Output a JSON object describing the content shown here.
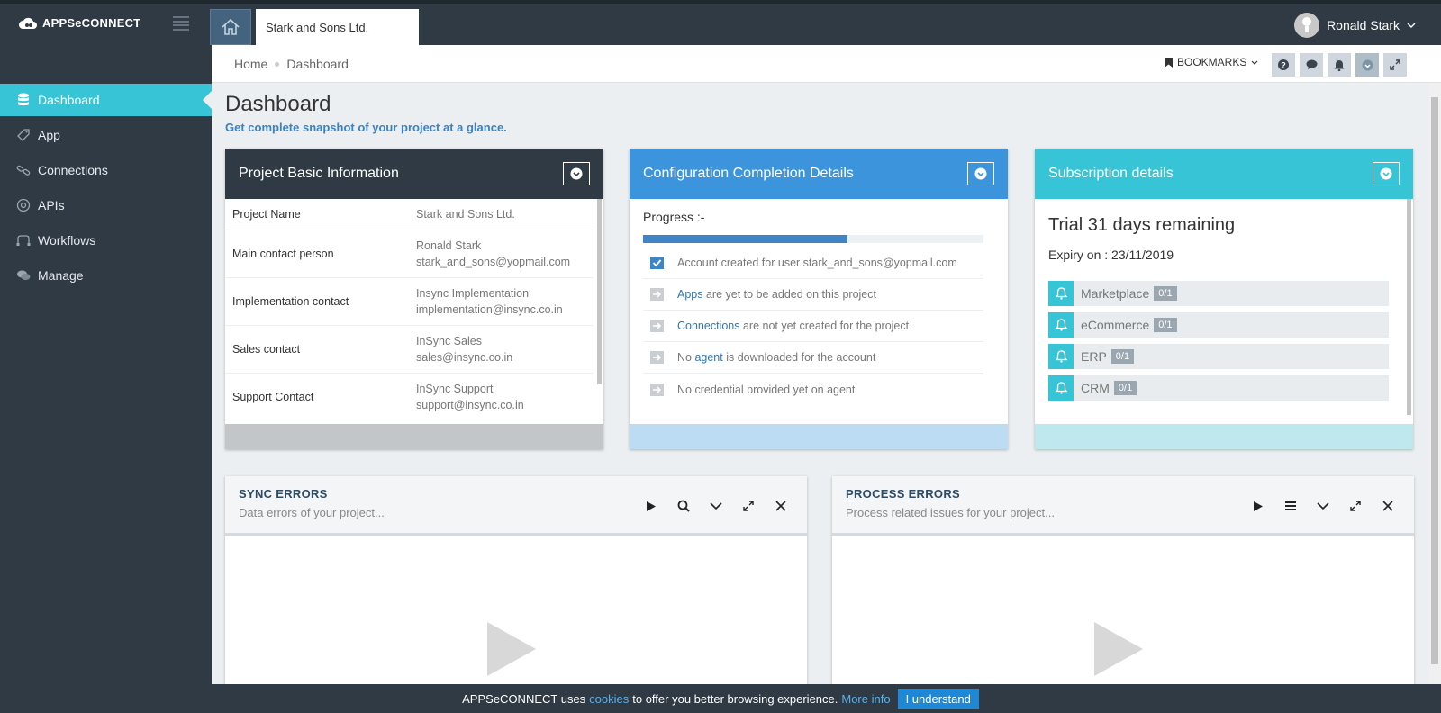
{
  "app": {
    "logo_text": "APPSeCONNECT"
  },
  "header": {
    "project_tab": "Stark and Sons Ltd.",
    "user_name": "Ronald Stark"
  },
  "sidebar": {
    "items": [
      {
        "label": "Dashboard",
        "icon": "database-icon",
        "active": true
      },
      {
        "label": "App",
        "icon": "tag-icon"
      },
      {
        "label": "Connections",
        "icon": "link-icon"
      },
      {
        "label": "APIs",
        "icon": "cog-icon"
      },
      {
        "label": "Workflows",
        "icon": "workflow-icon"
      },
      {
        "label": "Manage",
        "icon": "chat-icon"
      }
    ]
  },
  "breadcrumb": {
    "home": "Home",
    "current": "Dashboard",
    "bookmarks": "BOOKMARKS"
  },
  "page": {
    "title": "Dashboard",
    "subtitle": "Get complete snapshot of your project at a glance."
  },
  "project_card": {
    "title": "Project Basic Information",
    "rows": [
      {
        "key": "Project Name",
        "value": "Stark and Sons Ltd.",
        "value2": ""
      },
      {
        "key": "Main contact person",
        "value": "Ronald Stark",
        "value2": "stark_and_sons@yopmail.com"
      },
      {
        "key": "Implementation contact",
        "value": "Insync Implementation",
        "value2": "implementation@insync.co.in"
      },
      {
        "key": "Sales contact",
        "value": "InSync Sales",
        "value2": "sales@insync.co.in"
      },
      {
        "key": "Support Contact",
        "value": "InSync Support",
        "value2": "support@insync.co.in"
      }
    ]
  },
  "config_card": {
    "title": "Configuration Completion Details",
    "progress_label": "Progress :-",
    "progress_fraction": 0.6,
    "items": [
      {
        "pre": "",
        "link": "",
        "post": "Account created for user stark_and_sons@yopmail.com",
        "done": true
      },
      {
        "pre": "",
        "link": "Apps",
        "post": " are yet to be added on this project",
        "done": false
      },
      {
        "pre": "",
        "link": "Connections",
        "post": " are not yet created for the project",
        "done": false
      },
      {
        "pre": "No ",
        "link": "agent",
        "post": " is downloaded for the account",
        "done": false
      },
      {
        "pre": "",
        "link": "",
        "post": "No credential provided yet on agent",
        "done": false
      }
    ]
  },
  "subscription_card": {
    "title": "Subscription details",
    "trial": "Trial 31 days remaining",
    "expiry": "Expiry on : 23/11/2019",
    "items": [
      {
        "label": "Marketplace",
        "count": "0/1"
      },
      {
        "label": "eCommerce",
        "count": "0/1"
      },
      {
        "label": "ERP",
        "count": "0/1"
      },
      {
        "label": "CRM",
        "count": "0/1"
      }
    ]
  },
  "sync_errors": {
    "title": "SYNC ERRORS",
    "desc": "Data errors of your project..."
  },
  "process_errors": {
    "title": "PROCESS ERRORS",
    "desc": "Process related issues for your project..."
  },
  "cookie": {
    "text1": "APPSeCONNECT uses",
    "link": "cookies",
    "text2": "to offer you better browsing experience.",
    "more": "More info",
    "button": "I understand"
  },
  "colors": {
    "sidebar": "#2f3a45",
    "accent_teal": "#37c4d6",
    "accent_blue": "#3c94dd",
    "project_head": "#2f3a45"
  }
}
